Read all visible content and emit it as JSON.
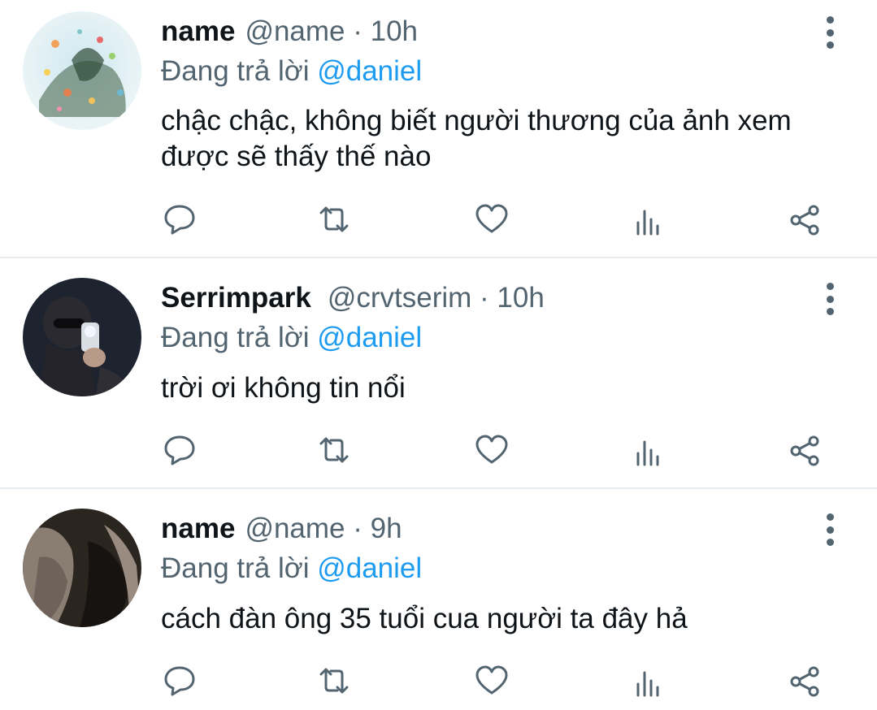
{
  "tweets": [
    {
      "display_name": "name",
      "handle_time": "@name · 10h",
      "reply_prefix": "Đang trả lời",
      "reply_to": "@daniel",
      "text": "chậc chậc, không biết người thương của ảnh xem được sẽ thấy thế nào",
      "avatar": "avatar-aquarium-image"
    },
    {
      "display_name": "Serrimpark",
      "handle_time": "@crvtserim · 10h",
      "reply_prefix": "Đang trả lời",
      "reply_to": "@daniel",
      "text": "trời ơi không tin nổi",
      "avatar": "avatar-mirror-selfie-image"
    },
    {
      "display_name": "name",
      "handle_time": "@name · 9h",
      "reply_prefix": "Đang trả lời",
      "reply_to": "@daniel",
      "text": "cách đàn ông 35 tuổi cua người ta đây hả",
      "avatar": "avatar-dark-photo-image"
    }
  ],
  "action_icons": [
    "reply-icon",
    "retweet-icon",
    "like-icon",
    "analytics-icon",
    "share-icon"
  ],
  "colors": {
    "mention": "#1d9bf0",
    "secondary_text": "#536471",
    "primary_text": "#0f1419",
    "divider": "#e6ecf0"
  }
}
